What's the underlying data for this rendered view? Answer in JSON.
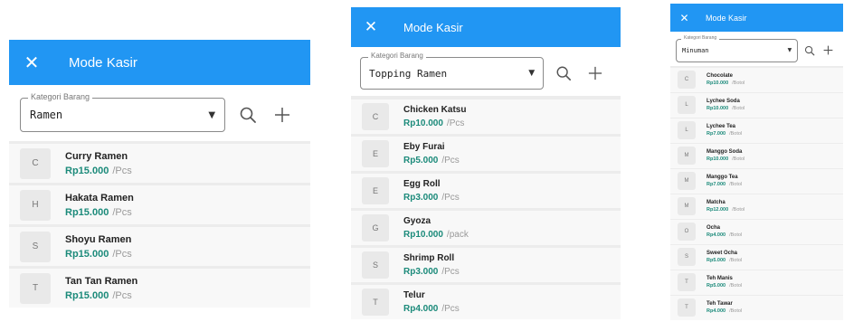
{
  "app": {
    "title": "Mode Kasir",
    "close_glyph": "✕"
  },
  "field_label": "Kategori Barang",
  "screens": [
    {
      "category": "Ramen",
      "items": [
        {
          "initial": "C",
          "name": "Curry Ramen",
          "price": "Rp15.000",
          "unit": "/Pcs"
        },
        {
          "initial": "H",
          "name": "Hakata Ramen",
          "price": "Rp15.000",
          "unit": "/Pcs"
        },
        {
          "initial": "S",
          "name": "Shoyu Ramen",
          "price": "Rp15.000",
          "unit": "/Pcs"
        },
        {
          "initial": "T",
          "name": "Tan Tan Ramen",
          "price": "Rp15.000",
          "unit": "/Pcs"
        }
      ]
    },
    {
      "category": "Topping Ramen",
      "items": [
        {
          "initial": "C",
          "name": "Chicken Katsu",
          "price": "Rp10.000",
          "unit": "/Pcs"
        },
        {
          "initial": "E",
          "name": "Eby Furai",
          "price": "Rp5.000",
          "unit": "/Pcs"
        },
        {
          "initial": "E",
          "name": "Egg Roll",
          "price": "Rp3.000",
          "unit": "/Pcs"
        },
        {
          "initial": "G",
          "name": "Gyoza",
          "price": "Rp10.000",
          "unit": "/pack"
        },
        {
          "initial": "S",
          "name": "Shrimp Roll",
          "price": "Rp3.000",
          "unit": "/Pcs"
        },
        {
          "initial": "T",
          "name": "Telur",
          "price": "Rp4.000",
          "unit": "/Pcs"
        }
      ]
    },
    {
      "category": "Minuman",
      "items": [
        {
          "initial": "C",
          "name": "Chocolate",
          "price": "Rp10.000",
          "unit": "/Botol"
        },
        {
          "initial": "L",
          "name": "Lychee Soda",
          "price": "Rp10.000",
          "unit": "/Botol"
        },
        {
          "initial": "L",
          "name": "Lychee Tea",
          "price": "Rp7.000",
          "unit": "/Botol"
        },
        {
          "initial": "M",
          "name": "Manggo Soda",
          "price": "Rp10.000",
          "unit": "/Botol"
        },
        {
          "initial": "M",
          "name": "Manggo Tea",
          "price": "Rp7.000",
          "unit": "/Botol"
        },
        {
          "initial": "M",
          "name": "Matcha",
          "price": "Rp12.000",
          "unit": "/Botol"
        },
        {
          "initial": "O",
          "name": "Ocha",
          "price": "Rp4.000",
          "unit": "/Botol"
        },
        {
          "initial": "S",
          "name": "Sweet Ocha",
          "price": "Rp5.000",
          "unit": "/Botol"
        },
        {
          "initial": "T",
          "name": "Teh Manis",
          "price": "Rp5.000",
          "unit": "/Botol"
        },
        {
          "initial": "T",
          "name": "Teh Tawar",
          "price": "Rp4.000",
          "unit": "/Botol"
        }
      ]
    }
  ],
  "colors": {
    "appbar": "#2196f3",
    "price": "#1b8a7a"
  },
  "icons": [
    "close-icon",
    "dropdown-caret-icon",
    "search-icon",
    "add-icon"
  ]
}
